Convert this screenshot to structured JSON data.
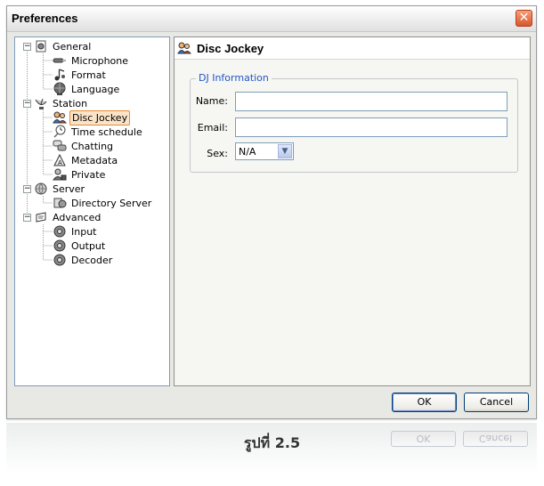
{
  "window": {
    "title": "Preferences"
  },
  "tree": [
    {
      "label": "General",
      "icon": "general-settings-icon",
      "level": 0,
      "expander": "−"
    },
    {
      "label": "Microphone",
      "icon": "microphone-icon",
      "level": 1
    },
    {
      "label": "Format",
      "icon": "music-note-icon",
      "level": 1
    },
    {
      "label": "Language",
      "icon": "globe-icon",
      "level": 1
    },
    {
      "label": "Station",
      "icon": "satellite-dish-icon",
      "level": 0,
      "expander": "−"
    },
    {
      "label": "Disc Jockey",
      "icon": "dj-people-icon",
      "level": 1,
      "selected": true
    },
    {
      "label": "Time schedule",
      "icon": "clock-icon",
      "level": 1
    },
    {
      "label": "Chatting",
      "icon": "chat-icon",
      "level": 1
    },
    {
      "label": "Metadata",
      "icon": "metadata-icon",
      "level": 1
    },
    {
      "label": "Private",
      "icon": "private-icon",
      "level": 1
    },
    {
      "label": "Server",
      "icon": "server-icon",
      "level": 0,
      "expander": "−"
    },
    {
      "label": "Directory Server",
      "icon": "directory-server-icon",
      "level": 1
    },
    {
      "label": "Advanced",
      "icon": "advanced-icon",
      "level": 0,
      "expander": "−"
    },
    {
      "label": "Input",
      "icon": "gear-input-icon",
      "level": 1
    },
    {
      "label": "Output",
      "icon": "gear-output-icon",
      "level": 1
    },
    {
      "label": "Decoder",
      "icon": "gear-decoder-icon",
      "level": 1
    }
  ],
  "content": {
    "title": "Disc Jockey",
    "group": "DJ Information",
    "fields": {
      "name_label": "Name:",
      "name_value": "",
      "email_label": "Email:",
      "email_value": "",
      "sex_label": "Sex:",
      "sex_value": "N/A"
    }
  },
  "buttons": {
    "ok": "OK",
    "cancel": "Cancel"
  },
  "caption": "รูปที่ 2.5",
  "colors": {
    "accent": "#2157c6",
    "selection_border": "#e58b32",
    "close": "#d8552b"
  }
}
